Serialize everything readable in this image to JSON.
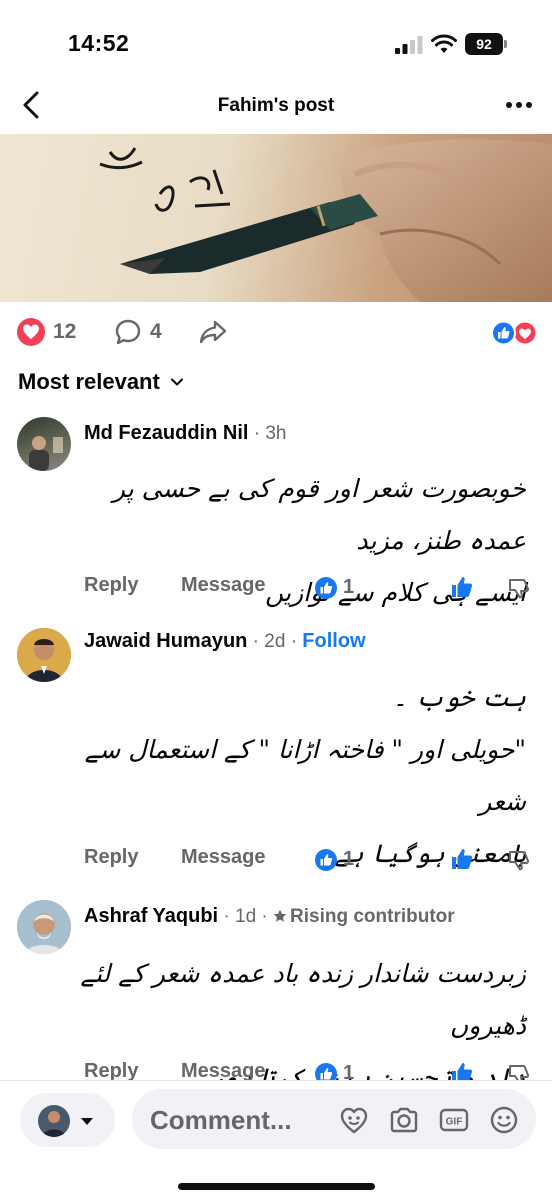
{
  "status": {
    "time": "14:52",
    "battery": "92"
  },
  "nav": {
    "title": "Fahim's post"
  },
  "post_image": {
    "caption": ""
  },
  "reactions": {
    "love_count": "12",
    "comment_count": "4"
  },
  "sort": {
    "label": "Most relevant"
  },
  "comments": [
    {
      "name": "Md Fezauddin Nil",
      "meta": " · 3h",
      "text_lines": [
        "خوبصورت شعر اور قوم کی بے حسی پر عمدہ طنز، مزید",
        "ایسے ہی کلام سے نوازیں"
      ],
      "reply": "Reply",
      "message": "Message",
      "likes": "1"
    },
    {
      "name": "Jawaid Humayun",
      "meta": " · 2d · ",
      "follow": "Follow",
      "text_lines": [
        "ہت خوب ۔",
        "\"حویلی اور \" فاختہ اڑانا \" کے استعمال سے شعر",
        "بامعنی ہوگیا ہے ۔"
      ],
      "reply": "Reply",
      "message": "Message",
      "likes": "1"
    },
    {
      "name": "Ashraf Yaqubi",
      "meta": " · 1d · ",
      "badge": "Rising contributor",
      "text_lines": [
        "زبردست شاندار زندہ باد عمدہ شعر کے لئے ڈھیروں",
        "داد و تحسین پیش کرتا ہوں"
      ],
      "reply": "Reply",
      "message": "Message",
      "likes": "1"
    }
  ],
  "composer": {
    "placeholder": "Comment..."
  },
  "colors": {
    "brand_blue": "#1877f2",
    "love_red": "#f33e58",
    "meta_gray": "#65676b"
  }
}
